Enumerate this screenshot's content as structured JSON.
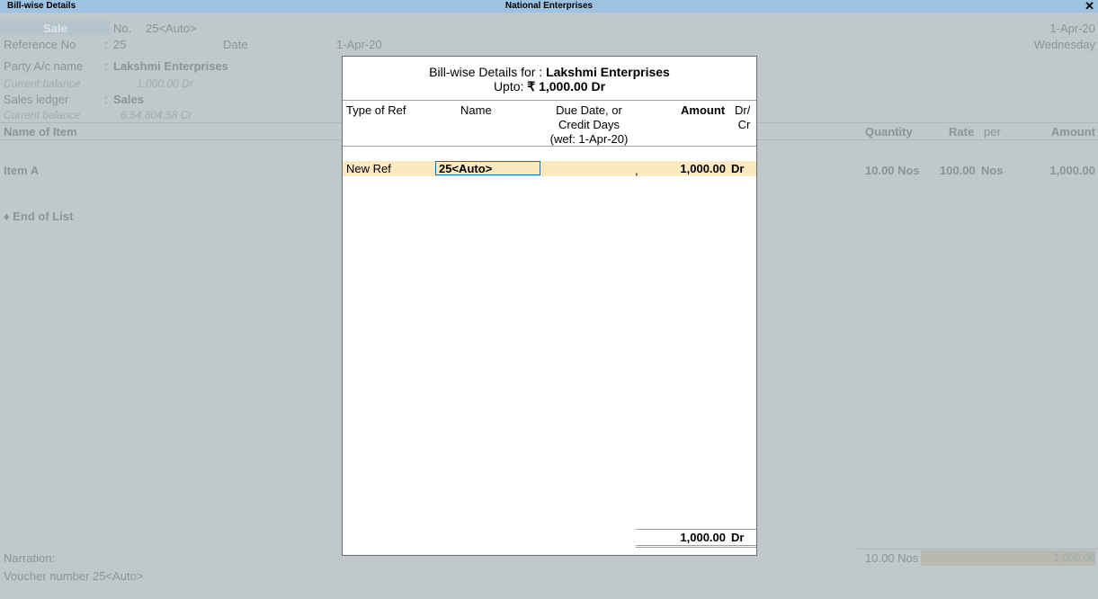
{
  "window": {
    "title_left": "Bill-wise Details",
    "title_center": "National Enterprises",
    "close_icon": "close-icon",
    "close_glyph": "✕"
  },
  "voucher": {
    "type": "Sale",
    "no_label": "No.",
    "no_value": "25<Auto>",
    "date_top": "1-Apr-20",
    "weekday": "Wednesday",
    "ref_label": "Reference No",
    "ref_colon": ":",
    "ref_value": "25",
    "date_label": "Date",
    "date_value": "1-Apr-20",
    "party_label": "Party A/c name",
    "party_value": "Lakshmi Enterprises",
    "cur_bal_label": "Current balance",
    "party_balance": "1,000.00 Dr",
    "sales_ledger_label": "Sales ledger",
    "sales_ledger_value": "Sales",
    "sales_balance": "6,54,804.58 Cr",
    "col_item": "Name of Item",
    "col_qty": "Quantity",
    "col_rate": "Rate",
    "col_per": "per",
    "col_amount": "Amount",
    "item_name": "Item A",
    "item_qty": "10.00 Nos",
    "item_rate": "100.00",
    "item_per": "Nos",
    "item_amount": "1,000.00",
    "end_of_list": "♦ End of List",
    "narration_label": "Narration:",
    "total_qty": "10.00 Nos",
    "total_amount": "1,000.00",
    "voucher_number_text": "Voucher number 25<Auto>"
  },
  "dialog": {
    "title_prefix": "Bill-wise Details for :",
    "party": "Lakshmi Enterprises",
    "upto_label": "Upto:",
    "upto_value": "₹ 1,000.00 Dr",
    "col_type": "Type of Ref",
    "col_name": "Name",
    "col_due_1": "Due Date, or",
    "col_due_2": "Credit Days",
    "col_due_3": "(wef: 1-Apr-20)",
    "col_amount": "Amount",
    "col_drcr_1": "Dr/",
    "col_drcr_2": "Cr",
    "row": {
      "type": "New Ref",
      "name": "25<Auto>",
      "due": ",",
      "amount": "1,000.00",
      "drcr": "Dr"
    },
    "total_amount": "1,000.00",
    "total_drcr": "Dr"
  }
}
